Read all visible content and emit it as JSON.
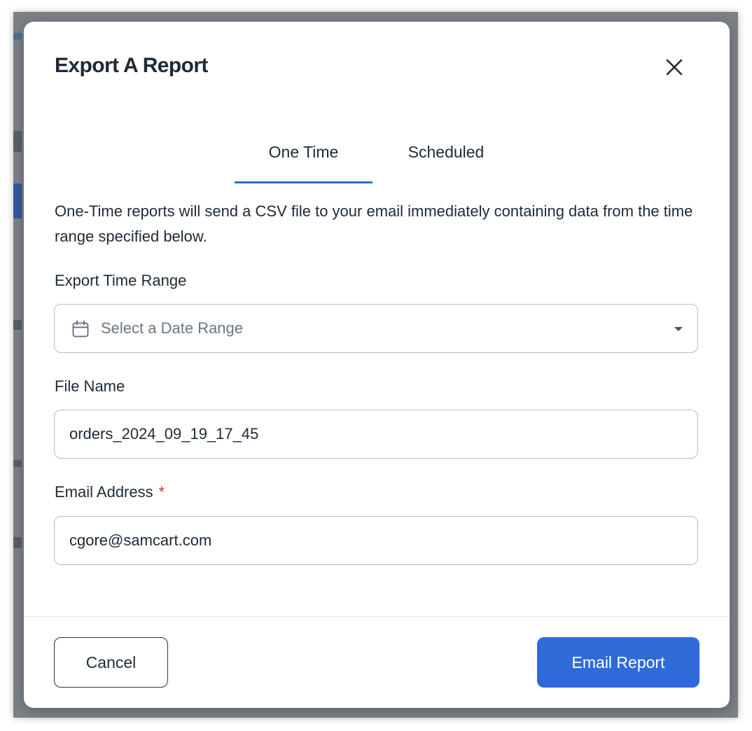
{
  "dialog": {
    "title": "Export A Report",
    "close_icon": "close-icon"
  },
  "tabs": [
    {
      "label": "One Time",
      "active": true
    },
    {
      "label": "Scheduled",
      "active": false
    }
  ],
  "description": "One-Time reports will send a CSV file to your email immediately containing data from the time range specified below.",
  "fields": {
    "time_range": {
      "label": "Export Time Range",
      "placeholder": "Select a Date Range",
      "icon": "calendar-icon",
      "dropdown_icon": "caret-down-icon"
    },
    "file_name": {
      "label": "File Name",
      "value": "orders_2024_09_19_17_45"
    },
    "email": {
      "label": "Email Address",
      "required_mark": "*",
      "value": "cgore@samcart.com"
    }
  },
  "footer": {
    "cancel_label": "Cancel",
    "submit_label": "Email Report"
  },
  "colors": {
    "accent": "#2f6bd8",
    "required": "#d0342c",
    "text": "#1f2a37",
    "placeholder": "#6b7684",
    "overlay": "#7d8188"
  }
}
